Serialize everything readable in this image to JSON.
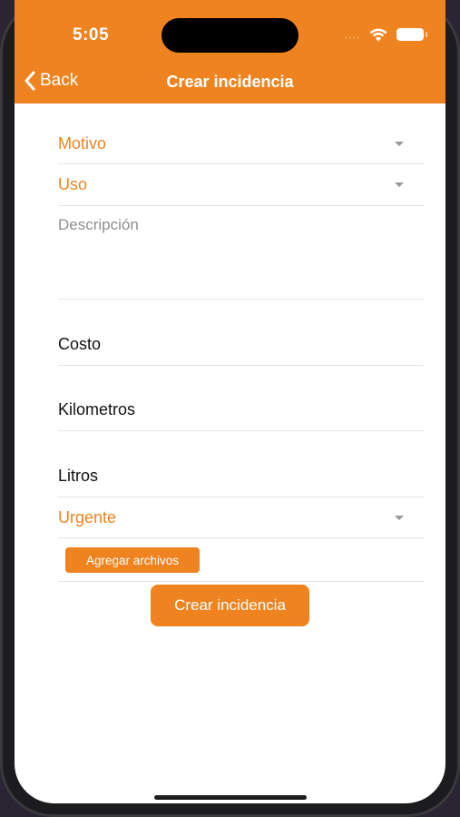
{
  "status_bar": {
    "time": "5:05",
    "signal": "....",
    "wifi_icon": "wifi-icon",
    "battery_icon": "battery-icon"
  },
  "nav": {
    "back_label": "Back",
    "title": "Crear incidencia"
  },
  "form": {
    "motivo": {
      "label": "Motivo"
    },
    "uso": {
      "label": "Uso"
    },
    "descripcion": {
      "placeholder": "Descripción"
    },
    "costo": {
      "label": "Costo"
    },
    "kilometros": {
      "label": "Kilometros"
    },
    "litros": {
      "label": "Litros"
    },
    "urgente": {
      "label": "Urgente"
    },
    "add_files_label": "Agregar archivos"
  },
  "submit_label": "Crear incidencia",
  "colors": {
    "accent": "#ee8320",
    "placeholder": "#8e8e93",
    "divider": "#e5e5e5"
  }
}
